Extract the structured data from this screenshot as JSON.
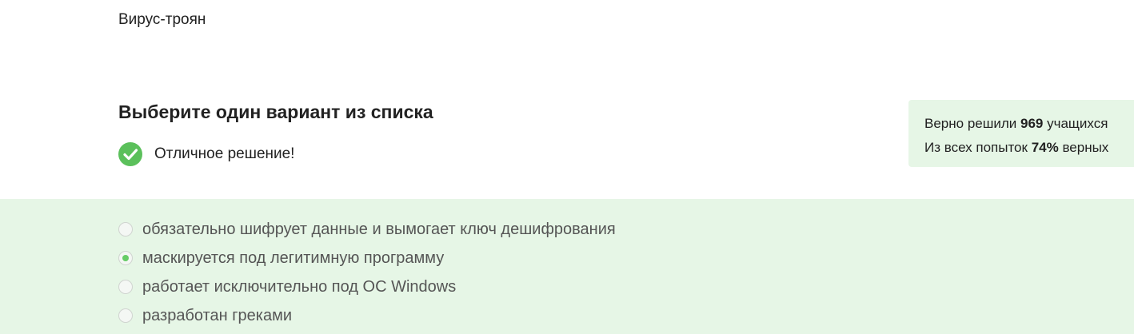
{
  "step": {
    "text": "Вирус-троян"
  },
  "quiz": {
    "title": "Выберите один вариант из списка",
    "feedback": {
      "icon": "check-circle-icon",
      "text": "Отличное решение!",
      "color": "#5bc05b"
    },
    "options": [
      {
        "label": "обязательно шифрует данные и вымогает ключ дешифрования",
        "selected": false
      },
      {
        "label": "маскируется под легитимную программу",
        "selected": true
      },
      {
        "label": "работает исключительно под ОС Windows",
        "selected": false
      },
      {
        "label": "разработан греками",
        "selected": false
      }
    ]
  },
  "stats": {
    "line1_prefix": "Верно решили ",
    "solved_count": "969",
    "line1_suffix": " учащихся",
    "line2_prefix": "Из всех попыток ",
    "correct_percent": "74%",
    "line2_suffix": " верных"
  },
  "colors": {
    "accent": "#66cc66",
    "panel_background": "#e6f6e6"
  }
}
